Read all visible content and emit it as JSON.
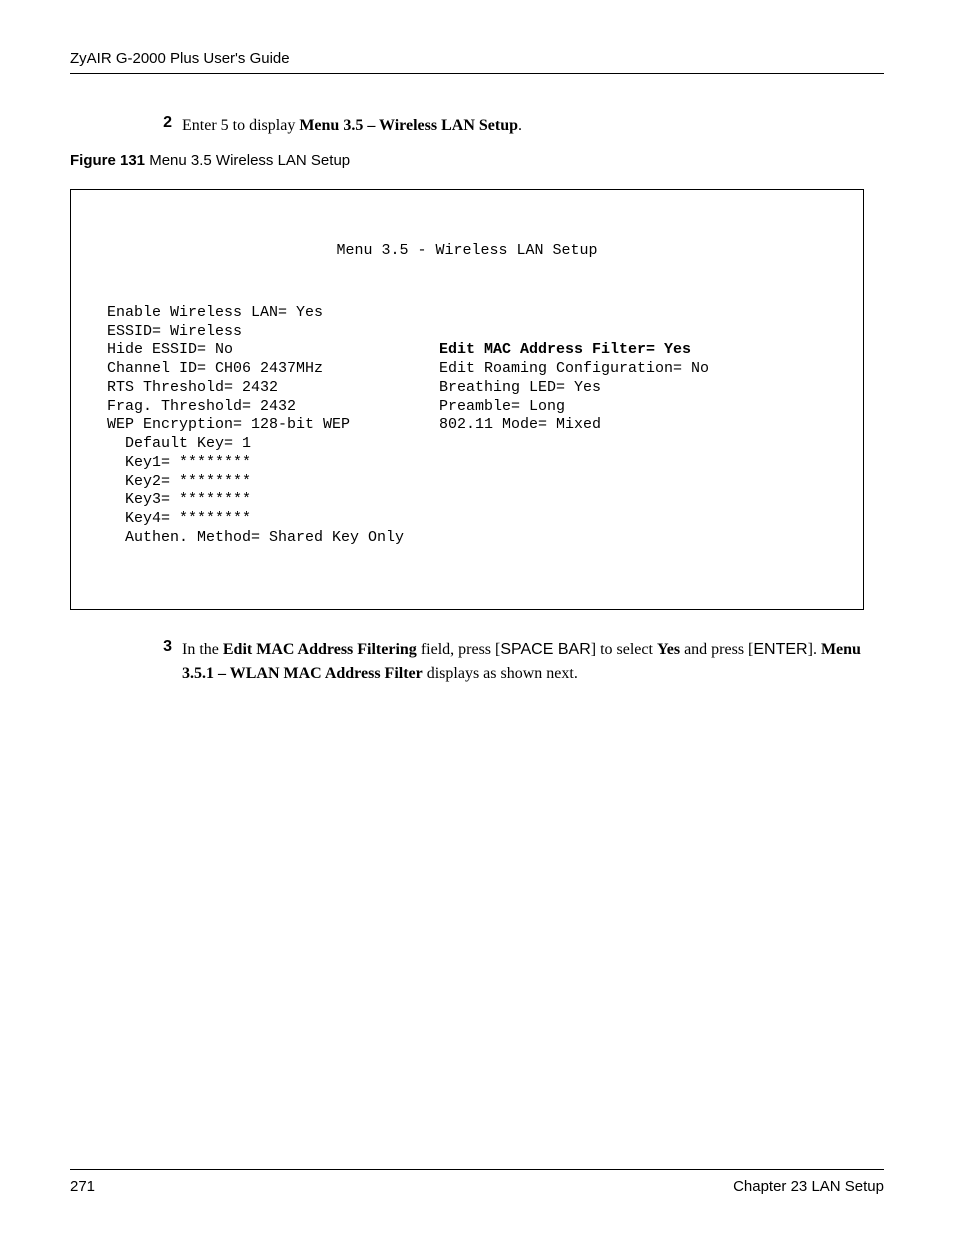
{
  "header": {
    "doc_title": "ZyAIR G-2000 Plus User's Guide"
  },
  "step2": {
    "num": "2",
    "prefix": "Enter 5 to display ",
    "bold": "Menu 3.5 – Wireless LAN Setup",
    "suffix": "."
  },
  "figure": {
    "label": "Figure 131   ",
    "caption": "Menu 3.5 Wireless LAN Setup"
  },
  "terminal": {
    "title": "Menu 3.5 - Wireless LAN Setup",
    "left": {
      "l1": "  Enable Wireless LAN= Yes",
      "l2": "  ESSID= Wireless",
      "l3": "  Hide ESSID= No",
      "l4": "  Channel ID= CH06 2437MHz",
      "l5": "  RTS Threshold= 2432",
      "l6": "  Frag. Threshold= 2432",
      "l7": "  WEP Encryption= 128-bit WEP",
      "l8": "    Default Key= 1",
      "l9": "    Key1= ********",
      "l10": "    Key2= ********",
      "l11": "    Key3= ********",
      "l12": "    Key4= ********",
      "l13": "    Authen. Method= Shared Key Only"
    },
    "right": {
      "r1": "",
      "r2": "",
      "r3_bold": "Edit MAC Address Filter= Yes",
      "r4": "Edit Roaming Configuration= No",
      "r5": "Breathing LED= Yes",
      "r6": "Preamble= Long",
      "r7": "802.11 Mode= Mixed"
    }
  },
  "step3": {
    "num": "3",
    "t1": "In the ",
    "b1": "Edit MAC Address Filtering",
    "t2": " field, press [",
    "s1": "SPACE BAR",
    "t3": "] to select ",
    "b2": "Yes",
    "t4": " and press [",
    "s2": "ENTER",
    "t5": "]. ",
    "b3": "Menu 3.5.1 – WLAN MAC Address Filter",
    "t6": " displays as shown next."
  },
  "footer": {
    "page_number": "271",
    "chapter": "Chapter 23 LAN Setup"
  }
}
